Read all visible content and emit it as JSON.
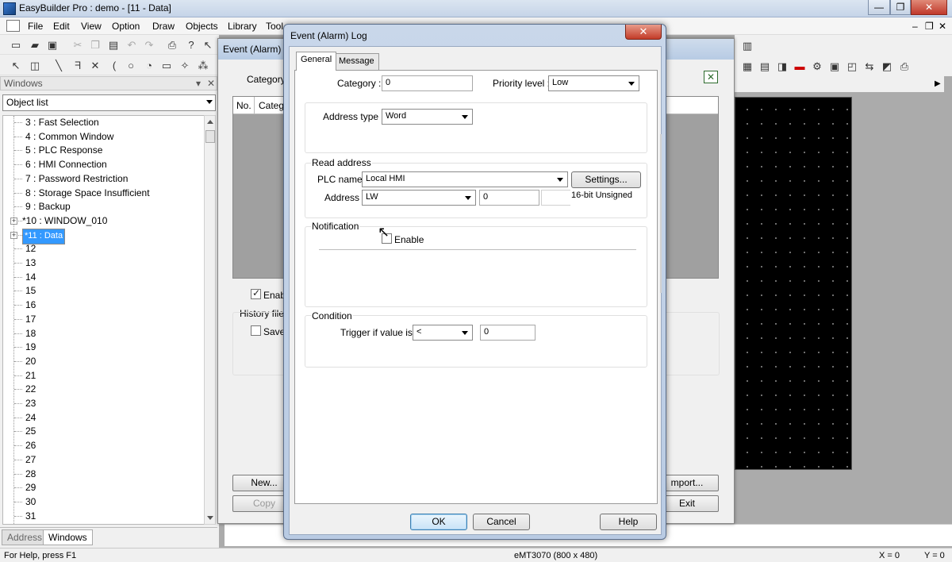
{
  "app": {
    "title": "EasyBuilder Pro : demo - [11 - Data]",
    "window_buttons": [
      "—",
      "❐",
      "✕"
    ],
    "mdi_buttons": [
      "–",
      "❐",
      "✕"
    ]
  },
  "menu": [
    "File",
    "Edit",
    "View",
    "Option",
    "Draw",
    "Objects",
    "Library",
    "Tool"
  ],
  "panel": {
    "header": "Windows",
    "pin": "▾",
    "close": "✕",
    "select_value": "Object list",
    "tree": [
      {
        "label": "3 : Fast Selection"
      },
      {
        "label": "4 : Common Window"
      },
      {
        "label": "5 : PLC Response"
      },
      {
        "label": "6 : HMI Connection"
      },
      {
        "label": "7 : Password Restriction"
      },
      {
        "label": "8 : Storage Space Insufficient"
      },
      {
        "label": "9 : Backup"
      },
      {
        "label": "*10 : WINDOW_010",
        "expander": true
      },
      {
        "label": "*11 : Data",
        "expander": true,
        "selected": true
      },
      {
        "label": "12"
      },
      {
        "label": "13"
      },
      {
        "label": "14"
      },
      {
        "label": "15"
      },
      {
        "label": "16"
      },
      {
        "label": "17"
      },
      {
        "label": "18"
      },
      {
        "label": "19"
      },
      {
        "label": "20"
      },
      {
        "label": "21"
      },
      {
        "label": "22"
      },
      {
        "label": "23"
      },
      {
        "label": "24"
      },
      {
        "label": "25"
      },
      {
        "label": "26"
      },
      {
        "label": "27"
      },
      {
        "label": "28"
      },
      {
        "label": "29"
      },
      {
        "label": "30"
      },
      {
        "label": "31"
      }
    ],
    "tabs": [
      "Address",
      "Windows"
    ]
  },
  "background_dialog": {
    "title": "Event (Alarm) L",
    "category_label": "Category",
    "col_no": "No.",
    "col_category": "Categ",
    "enable_label": "Enab",
    "history_label": "History file",
    "save_label": "Save",
    "new_button": "New...",
    "copy_button": "Copy",
    "import_button": "mport...",
    "exit_button": "Exit"
  },
  "dialog": {
    "title": "Event (Alarm) Log",
    "close": "✕",
    "tabs": [
      "General",
      "Message"
    ],
    "category_label": "Category :",
    "category_value": "0",
    "priority_label": "Priority level :",
    "priority_value": "Low",
    "address_type_label": "Address type :",
    "address_type_value": "Word",
    "read_address_title": "Read address",
    "plc_name_label": "PLC name :",
    "plc_name_value": "Local HMI",
    "settings_button": "Settings...",
    "address_label": "Address :",
    "address_device": "LW",
    "address_value": "0",
    "address_format": "16-bit Unsigned",
    "notification_title": "Notification",
    "enable_label": "Enable",
    "condition_title": "Condition",
    "trigger_label": "Trigger if value is :",
    "trigger_operator": "<",
    "trigger_value": "0",
    "ok_button": "OK",
    "cancel_button": "Cancel",
    "help_button": "Help"
  },
  "status": {
    "help": "For Help, press F1",
    "model": "eMT3070 (800 x 480)",
    "x": "X = 0",
    "y": "Y = 0"
  }
}
